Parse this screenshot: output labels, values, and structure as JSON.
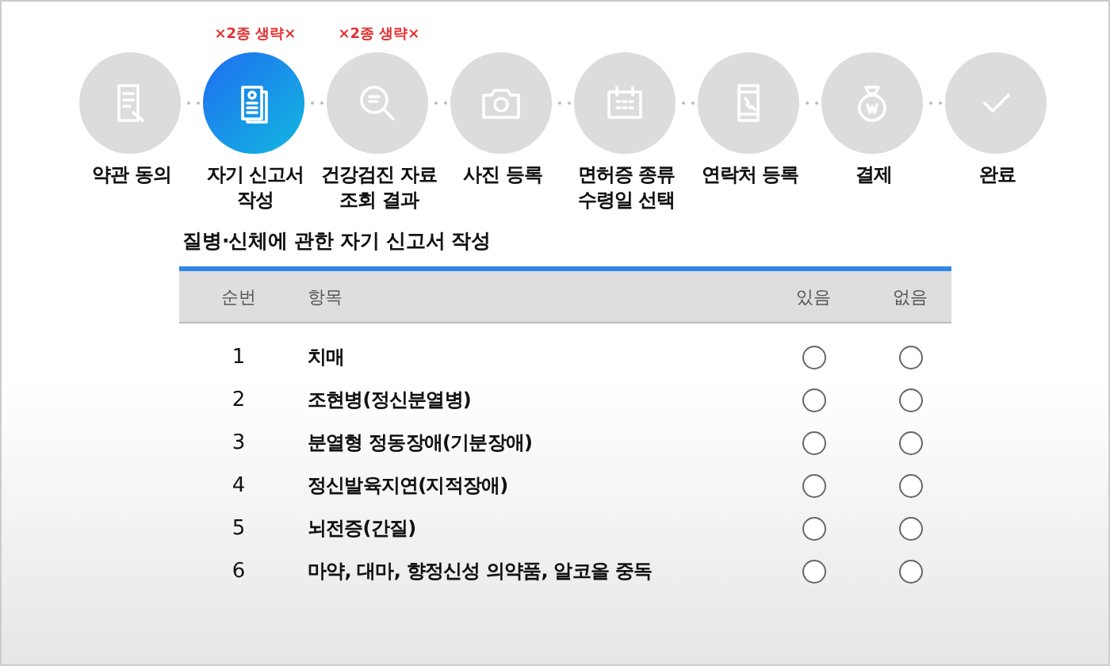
{
  "steps": [
    {
      "label": "약관 동의",
      "selected": false
    },
    {
      "label": "자기 신고서\n작성",
      "selected": true,
      "note": "×2종 생략×"
    },
    {
      "label": "건강검진 자료\n조회 결과",
      "selected": false,
      "note": "×2종 생략×"
    },
    {
      "label": "사진 등록",
      "selected": false
    },
    {
      "label": "면허증 종류\n수령일 선택",
      "selected": false
    },
    {
      "label": "연락처 등록",
      "selected": false
    },
    {
      "label": "결제",
      "selected": false
    },
    {
      "label": "완료",
      "selected": false
    }
  ],
  "section_title": "질병·신체에 관한 자기 신고서 작성",
  "table": {
    "columns": [
      "순번",
      "항목",
      "있음",
      "없음"
    ],
    "rows": [
      {
        "number": "1",
        "item": "치매",
        "yes_selected": false,
        "no_selected": false
      },
      {
        "number": "2",
        "item": "조현병(정신분열병)",
        "yes_selected": false,
        "no_selected": false
      },
      {
        "number": "3",
        "item": "분열형 정동장애(기분장애)",
        "yes_selected": false,
        "no_selected": false
      },
      {
        "number": "4",
        "item": "정신발육지연(지적장애)",
        "yes_selected": false,
        "no_selected": false
      },
      {
        "number": "5",
        "item": "뇌전증(간질)",
        "yes_selected": false,
        "no_selected": false
      },
      {
        "number": "6",
        "item": "마약, 대마, 향정신성 의약품, 알코올 중독",
        "yes_selected": false,
        "no_selected": false
      }
    ]
  }
}
